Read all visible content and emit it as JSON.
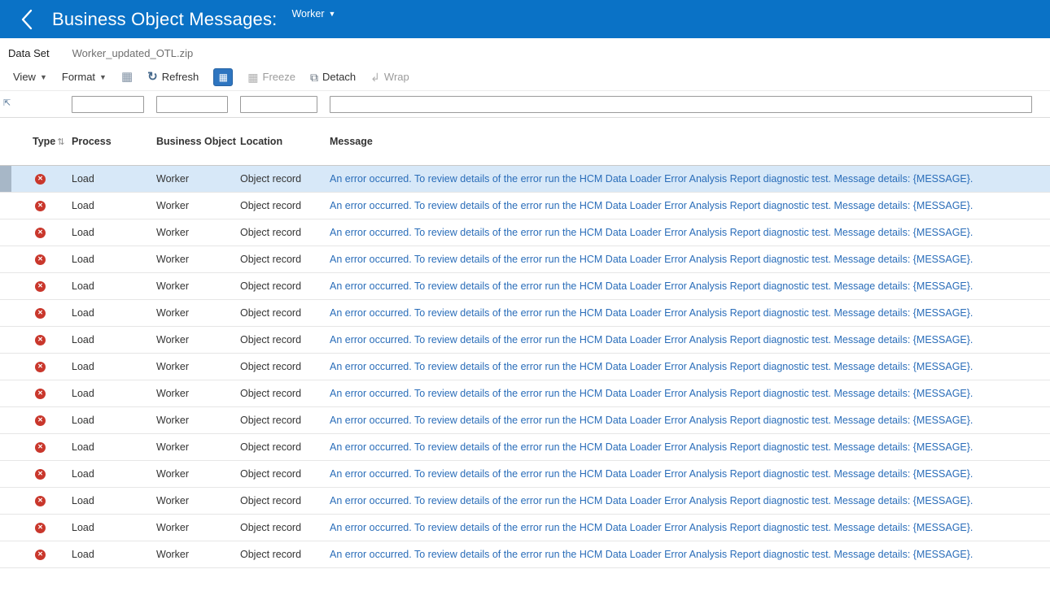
{
  "header": {
    "title": "Business Object Messages:",
    "object_selector": "Worker",
    "back_icon": "chevron-left"
  },
  "dataset": {
    "label": "Data Set",
    "value": "Worker_updated_OTL.zip"
  },
  "toolbar": {
    "view": "View",
    "format": "Format",
    "refresh": "Refresh",
    "freeze": "Freeze",
    "detach": "Detach",
    "wrap": "Wrap"
  },
  "filters": {
    "process": "",
    "business_object": "",
    "location": "",
    "message": ""
  },
  "colors": {
    "header_bg": "#0a72c6",
    "link": "#2a6db9",
    "error": "#c9372c",
    "selected_row": "#d7e8f8",
    "qbe_button": "#2e75c0"
  },
  "table": {
    "columns": {
      "type": "Type",
      "process": "Process",
      "business_object": "Business Object",
      "location": "Location",
      "message": "Message"
    },
    "selected_index": 0,
    "rows": [
      {
        "type": "error",
        "process": "Load",
        "business_object": "Worker",
        "location": "Object record",
        "message": "An error occurred. To review details of the error run the HCM Data Loader Error Analysis Report diagnostic test. Message details: {MESSAGE}."
      },
      {
        "type": "error",
        "process": "Load",
        "business_object": "Worker",
        "location": "Object record",
        "message": "An error occurred. To review details of the error run the HCM Data Loader Error Analysis Report diagnostic test. Message details: {MESSAGE}."
      },
      {
        "type": "error",
        "process": "Load",
        "business_object": "Worker",
        "location": "Object record",
        "message": "An error occurred. To review details of the error run the HCM Data Loader Error Analysis Report diagnostic test. Message details: {MESSAGE}."
      },
      {
        "type": "error",
        "process": "Load",
        "business_object": "Worker",
        "location": "Object record",
        "message": "An error occurred. To review details of the error run the HCM Data Loader Error Analysis Report diagnostic test. Message details: {MESSAGE}."
      },
      {
        "type": "error",
        "process": "Load",
        "business_object": "Worker",
        "location": "Object record",
        "message": "An error occurred. To review details of the error run the HCM Data Loader Error Analysis Report diagnostic test. Message details: {MESSAGE}."
      },
      {
        "type": "error",
        "process": "Load",
        "business_object": "Worker",
        "location": "Object record",
        "message": "An error occurred. To review details of the error run the HCM Data Loader Error Analysis Report diagnostic test. Message details: {MESSAGE}."
      },
      {
        "type": "error",
        "process": "Load",
        "business_object": "Worker",
        "location": "Object record",
        "message": "An error occurred. To review details of the error run the HCM Data Loader Error Analysis Report diagnostic test. Message details: {MESSAGE}."
      },
      {
        "type": "error",
        "process": "Load",
        "business_object": "Worker",
        "location": "Object record",
        "message": "An error occurred. To review details of the error run the HCM Data Loader Error Analysis Report diagnostic test. Message details: {MESSAGE}."
      },
      {
        "type": "error",
        "process": "Load",
        "business_object": "Worker",
        "location": "Object record",
        "message": "An error occurred. To review details of the error run the HCM Data Loader Error Analysis Report diagnostic test. Message details: {MESSAGE}."
      },
      {
        "type": "error",
        "process": "Load",
        "business_object": "Worker",
        "location": "Object record",
        "message": "An error occurred. To review details of the error run the HCM Data Loader Error Analysis Report diagnostic test. Message details: {MESSAGE}."
      },
      {
        "type": "error",
        "process": "Load",
        "business_object": "Worker",
        "location": "Object record",
        "message": "An error occurred. To review details of the error run the HCM Data Loader Error Analysis Report diagnostic test. Message details: {MESSAGE}."
      },
      {
        "type": "error",
        "process": "Load",
        "business_object": "Worker",
        "location": "Object record",
        "message": "An error occurred. To review details of the error run the HCM Data Loader Error Analysis Report diagnostic test. Message details: {MESSAGE}."
      },
      {
        "type": "error",
        "process": "Load",
        "business_object": "Worker",
        "location": "Object record",
        "message": "An error occurred. To review details of the error run the HCM Data Loader Error Analysis Report diagnostic test. Message details: {MESSAGE}."
      },
      {
        "type": "error",
        "process": "Load",
        "business_object": "Worker",
        "location": "Object record",
        "message": "An error occurred. To review details of the error run the HCM Data Loader Error Analysis Report diagnostic test. Message details: {MESSAGE}."
      },
      {
        "type": "error",
        "process": "Load",
        "business_object": "Worker",
        "location": "Object record",
        "message": "An error occurred. To review details of the error run the HCM Data Loader Error Analysis Report diagnostic test. Message details: {MESSAGE}."
      }
    ]
  }
}
